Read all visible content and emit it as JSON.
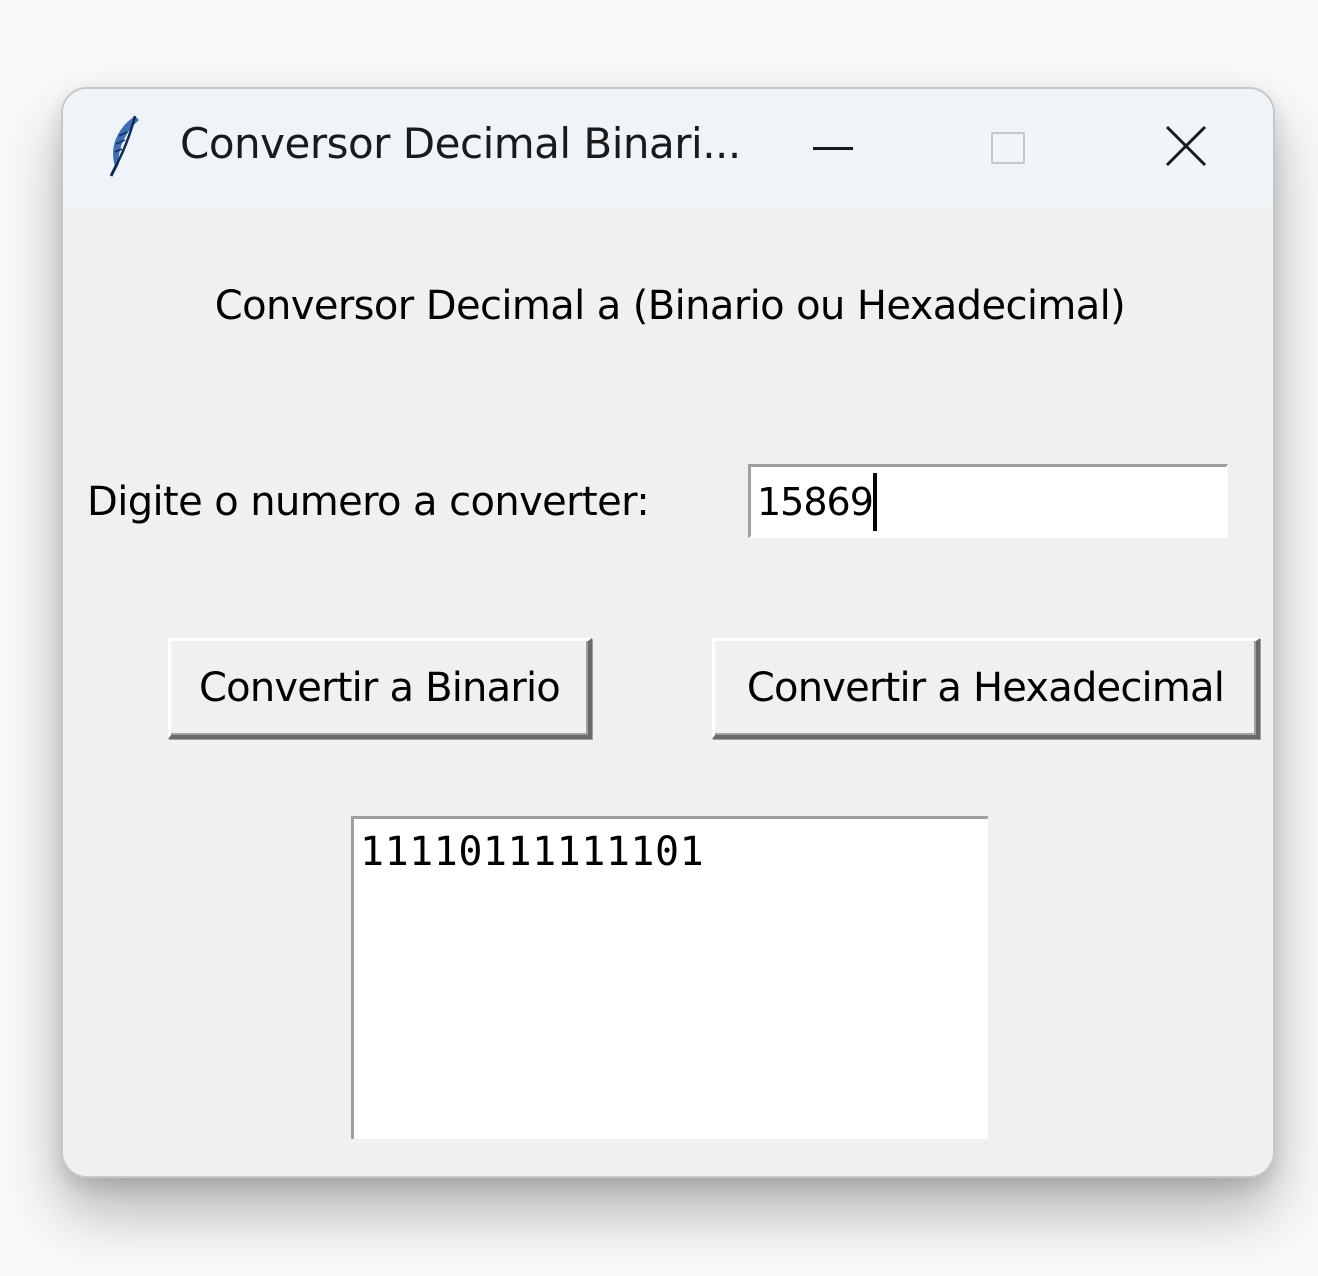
{
  "window": {
    "title": "Conversor Decimal Binari...",
    "app_icon": "feather-icon",
    "controls": {
      "minimize": "minimize-icon",
      "maximize": "maximize-icon",
      "close": "close-icon"
    }
  },
  "content": {
    "header": "Conversor Decimal a (Binario ou Hexadecimal)",
    "prompt_label": "Digite o numero a converter:",
    "input_value": "15869",
    "buttons": {
      "binario": "Convertir a Binario",
      "hexadecimal": "Convertir a Hexadecimal"
    },
    "output_text": "11110111111101"
  },
  "colors": {
    "titlebar_bg": "#eef4f8",
    "window_bg": "#f0f0f0",
    "field_bg": "#ffffff",
    "text": "#000000"
  }
}
